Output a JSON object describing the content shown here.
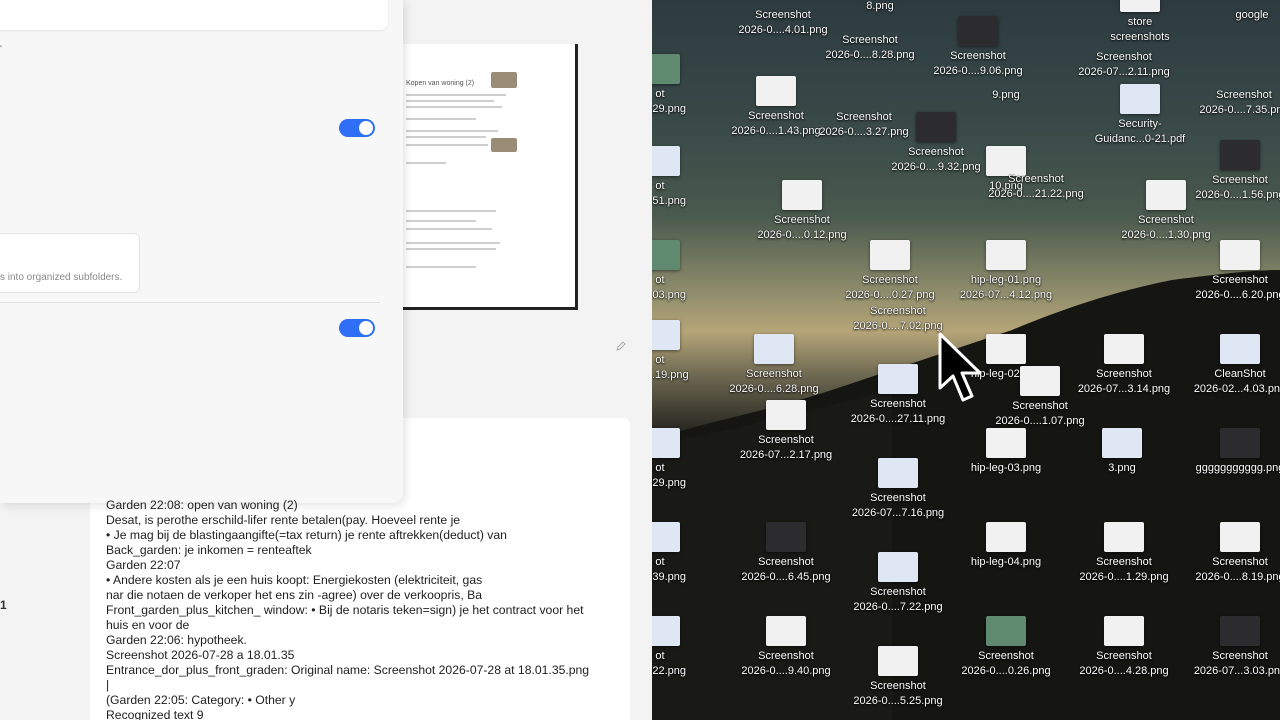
{
  "settings": {
    "description_text": "s into organized subfolders."
  },
  "preview": {
    "title": "Kopen van woning (2)"
  },
  "left_margin_char": "1",
  "left_top_char": "'",
  "ocr_lines": [
    "Garden 22:08: open van woning (2)",
    "Desat, is perothe erschild-lifer rente betalen(pay. Hoeveel rente je",
    "• Je mag bij de blastingaangifte(=tax return) je rente aftrekken(deduct) van",
    "Back_garden: je inkomen = renteaftek",
    "Garden 22:07",
    "• Andere kosten als je een huis koopt: Energiekosten (elektriciteit, gas",
    "nar die notaen de verkoper het ens zin -agree) over de verkoopris, Ba",
    "Front_garden_plus_kitchen_ window: • Bij de notaris teken=sign) je het contract voor het",
    "huis en voor de",
    "Garden 22:06: hypotheek.",
    "Screenshot 2026-07-28 a 18.01.35",
    "Entrance_dor_plus_front_graden: Original name: Screenshot 2026-07-28 at 18.01.35.png",
    "|",
    "(Garden 22:05: Category: • Other y",
    "Recognized text 9"
  ],
  "desktop_files": [
    {
      "l1": "",
      "l2": "8.png",
      "thumb": "doc"
    },
    {
      "l1": "Screenshot",
      "l2": "2026-0....4.01.png",
      "thumb": "none"
    },
    {
      "l1": "store",
      "l2": "screenshots",
      "thumb": "doc"
    },
    {
      "l1": "",
      "l2": "google",
      "thumb": "none"
    },
    {
      "l1": "Screenshot",
      "l2": "2026-0....8.28.png",
      "thumb": "none"
    },
    {
      "l1": "Screenshot",
      "l2": "2026-0....9.06.png",
      "thumb": "dark"
    },
    {
      "l1": "Screenshot",
      "l2": "2026-07...2.11.png",
      "thumb": "none"
    },
    {
      "l1": "",
      "l2": "9.png",
      "thumb": "none"
    },
    {
      "l1": "ot",
      "l2": "...3.29.png",
      "thumb": "pic"
    },
    {
      "l1": "Screenshot",
      "l2": "2026-0....1.43.png",
      "thumb": "doc"
    },
    {
      "l1": "Screenshot",
      "l2": "2026-0....3.27.png",
      "thumb": "none"
    },
    {
      "l1": "Security-",
      "l2": "Guidanc...0-21.pdf",
      "thumb": "blue"
    },
    {
      "l1": "Screenshot",
      "l2": "2026-0....7.35.png",
      "thumb": "none"
    },
    {
      "l1": "Screenshot",
      "l2": "2026-0....9.32.png",
      "thumb": "dark"
    },
    {
      "l1": "10.png",
      "l2": "",
      "thumb": "doc"
    },
    {
      "l1": "Screenshot",
      "l2": "2026-0....21.22.png",
      "thumb": "none"
    },
    {
      "l1": "ot",
      "l2": "...2.51.png",
      "thumb": "blue"
    },
    {
      "l1": "Screenshot",
      "l2": "2026-0....1.56.png",
      "thumb": "dark"
    },
    {
      "l1": "Screenshot",
      "l2": "2026-0....0.12.png",
      "thumb": "doc"
    },
    {
      "l1": "Screenshot",
      "l2": "2026-0....1.30.png",
      "thumb": "doc"
    },
    {
      "l1": "ot",
      "l2": "...0.03.png",
      "thumb": "pic"
    },
    {
      "l1": "Screenshot",
      "l2": "2026-0....0.27.png",
      "thumb": "doc"
    },
    {
      "l1": "hip-leg-01.png",
      "l2": "2026-07...4.12.png",
      "thumb": "doc"
    },
    {
      "l1": "Screenshot",
      "l2": "2026-0....6.20.png",
      "thumb": "doc"
    },
    {
      "l1": "Screenshot",
      "l2": "2026-0....7.02.png",
      "thumb": "none"
    },
    {
      "l1": "ot",
      "l2": "...11.19.png",
      "thumb": "blue"
    },
    {
      "l1": "Screenshot",
      "l2": "2026-0....6.28.png",
      "thumb": "blue"
    },
    {
      "l1": "hip-leg-02.png",
      "l2": "",
      "thumb": "doc"
    },
    {
      "l1": "Screenshot",
      "l2": "2026-07...3.14.png",
      "thumb": "doc"
    },
    {
      "l1": "CleanShot",
      "l2": "2026-02...4.03.png",
      "thumb": "blue"
    },
    {
      "l1": "Screenshot",
      "l2": "2026-0....27.11.png",
      "thumb": "blue"
    },
    {
      "l1": "Screenshot",
      "l2": "2026-0....1.07.png",
      "thumb": "doc"
    },
    {
      "l1": "Screenshot",
      "l2": "2026-07...2.17.png",
      "thumb": "doc"
    },
    {
      "l1": "hip-leg-03.png",
      "l2": "",
      "thumb": "doc"
    },
    {
      "l1": "3.png",
      "l2": "",
      "thumb": "blue"
    },
    {
      "l1": "ggggggggggg.png",
      "l2": "",
      "thumb": "dark"
    },
    {
      "l1": "ot",
      "l2": "...1.29.png",
      "thumb": "blue"
    },
    {
      "l1": "Screenshot",
      "l2": "2026-07...7.16.png",
      "thumb": "blue"
    },
    {
      "l1": "ot",
      "l2": "...5.39.png",
      "thumb": "blue"
    },
    {
      "l1": "Screenshot",
      "l2": "2026-0....6.45.png",
      "thumb": "dark"
    },
    {
      "l1": "hip-leg-04.png",
      "l2": "",
      "thumb": "doc"
    },
    {
      "l1": "Screenshot",
      "l2": "2026-0....1.29.png",
      "thumb": "doc"
    },
    {
      "l1": "Screenshot",
      "l2": "2026-0....8.19.png",
      "thumb": "doc"
    },
    {
      "l1": "Screenshot",
      "l2": "2026-0....7.22.png",
      "thumb": "blue"
    },
    {
      "l1": "ot",
      "l2": "...2.22.png",
      "thumb": "blue"
    },
    {
      "l1": "Screenshot",
      "l2": "2026-0....9.40.png",
      "thumb": "doc"
    },
    {
      "l1": "Screenshot",
      "l2": "2026-0....0.26.png",
      "thumb": "pic"
    },
    {
      "l1": "Screenshot",
      "l2": "2026-0....4.28.png",
      "thumb": "doc"
    },
    {
      "l1": "Screenshot",
      "l2": "2026-07...3.03.png",
      "thumb": "dark"
    },
    {
      "l1": "Screenshot",
      "l2": "2026-0....5.25.png",
      "thumb": "doc"
    }
  ]
}
